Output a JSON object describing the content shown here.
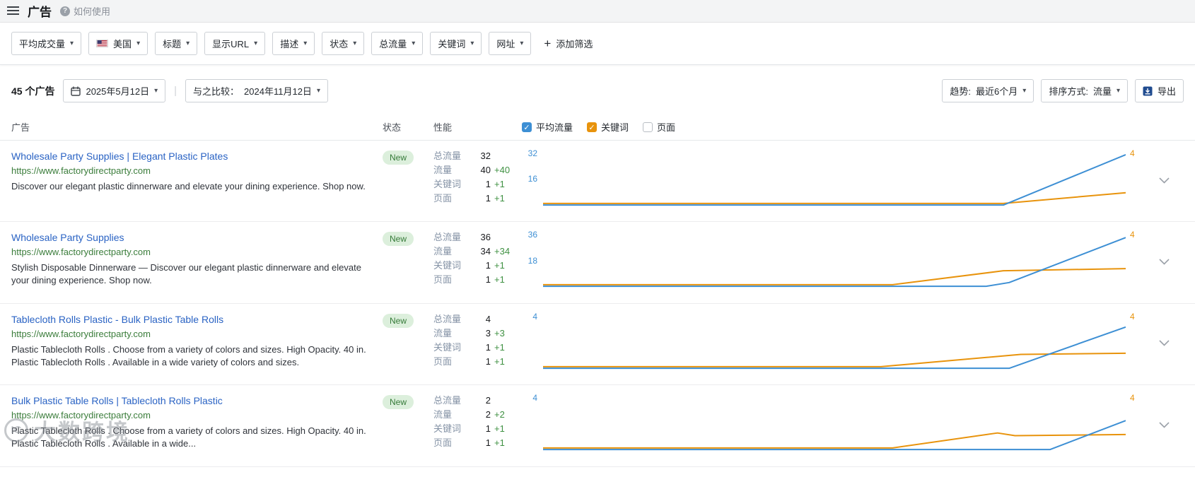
{
  "topbar": {
    "title": "广告",
    "help": "如何使用"
  },
  "filters": {
    "items": [
      {
        "label": "平均成交量",
        "flag": false
      },
      {
        "label": "美国",
        "flag": true
      },
      {
        "label": "标题",
        "flag": false
      },
      {
        "label": "显示URL",
        "flag": false
      },
      {
        "label": "描述",
        "flag": false
      },
      {
        "label": "状态",
        "flag": false
      },
      {
        "label": "总流量",
        "flag": false
      },
      {
        "label": "关键词",
        "flag": false
      },
      {
        "label": "网址",
        "flag": false
      }
    ],
    "add_label": "添加筛选"
  },
  "toolbar": {
    "count": "45 个广告",
    "date": "2025年5月12日",
    "compare_label": "与之比较：",
    "compare_value": "2024年11月12日",
    "trend_label": "趋势:",
    "trend_value": "最近6个月",
    "sort_label": "排序方式:",
    "sort_value": "流量",
    "export_label": "导出"
  },
  "table": {
    "columns": {
      "ad": "广告",
      "status": "状态",
      "performance": "性能"
    },
    "toggles": [
      {
        "label": "平均流量",
        "checked": true,
        "color": "#3d8fd4"
      },
      {
        "label": "关键词",
        "checked": true,
        "color": "#e8930c"
      },
      {
        "label": "页面",
        "checked": false,
        "color": ""
      }
    ]
  },
  "colors": {
    "series_blue": "#3d8fd4",
    "series_orange": "#e8930c"
  },
  "rows": [
    {
      "title": "Wholesale Party Supplies | Elegant Plastic Plates",
      "url": "https://www.factorydirectparty.com",
      "description": "Discover our elegant plastic dinnerware and elevate your dining experience. Shop now.",
      "status": "New",
      "metrics": [
        {
          "label": "总流量",
          "value": "32",
          "delta": ""
        },
        {
          "label": "流量",
          "value": "40",
          "delta": "+40"
        },
        {
          "label": "关键词",
          "value": "1",
          "delta": "+1"
        },
        {
          "label": "页面",
          "value": "1",
          "delta": "+1"
        }
      ],
      "chart": {
        "left_labels": [
          {
            "text": "32",
            "pos": 0
          },
          {
            "text": "16",
            "pos": 0.44
          }
        ],
        "right_labels": [
          {
            "text": "4",
            "pos": 0
          }
        ],
        "series": [
          {
            "color": "orange",
            "points": [
              [
                0,
                0.04
              ],
              [
                0.79,
                0.04
              ],
              [
                1,
                0.24
              ]
            ]
          },
          {
            "color": "blue",
            "points": [
              [
                0,
                0.01
              ],
              [
                0.79,
                0.01
              ],
              [
                1,
                0.95
              ]
            ]
          }
        ]
      }
    },
    {
      "title": "Wholesale Party Supplies",
      "url": "https://www.factorydirectparty.com",
      "description": "Stylish Disposable Dinnerware — Discover our elegant plastic dinnerware and elevate your dining experience. Shop now.",
      "status": "New",
      "metrics": [
        {
          "label": "总流量",
          "value": "36",
          "delta": ""
        },
        {
          "label": "流量",
          "value": "34",
          "delta": "+34"
        },
        {
          "label": "关键词",
          "value": "1",
          "delta": "+1"
        },
        {
          "label": "页面",
          "value": "1",
          "delta": "+1"
        }
      ],
      "chart": {
        "left_labels": [
          {
            "text": "36",
            "pos": 0
          },
          {
            "text": "18",
            "pos": 0.44
          }
        ],
        "right_labels": [
          {
            "text": "4",
            "pos": 0
          }
        ],
        "series": [
          {
            "color": "orange",
            "points": [
              [
                0,
                0.04
              ],
              [
                0.6,
                0.04
              ],
              [
                0.79,
                0.3
              ],
              [
                1,
                0.34
              ]
            ]
          },
          {
            "color": "blue",
            "points": [
              [
                0,
                0.01
              ],
              [
                0.76,
                0.01
              ],
              [
                0.8,
                0.08
              ],
              [
                1,
                0.92
              ]
            ]
          }
        ]
      }
    },
    {
      "title": "Tablecloth Rolls Plastic - Bulk Plastic Table Rolls",
      "url": "https://www.factorydirectparty.com",
      "description": "Plastic Tablecloth Rolls . Choose from a variety of colors and sizes. High Opacity. 40 in. Plastic Tablecloth Rolls . Available in a wide variety of colors and sizes.",
      "status": "New",
      "metrics": [
        {
          "label": "总流量",
          "value": "4",
          "delta": ""
        },
        {
          "label": "流量",
          "value": "3",
          "delta": "+3"
        },
        {
          "label": "关键词",
          "value": "1",
          "delta": "+1"
        },
        {
          "label": "页面",
          "value": "1",
          "delta": "+1"
        }
      ],
      "chart": {
        "left_labels": [
          {
            "text": "4",
            "pos": 0
          }
        ],
        "right_labels": [
          {
            "text": "4",
            "pos": 0
          }
        ],
        "series": [
          {
            "color": "orange",
            "points": [
              [
                0,
                0.04
              ],
              [
                0.58,
                0.04
              ],
              [
                0.82,
                0.27
              ],
              [
                1,
                0.29
              ]
            ]
          },
          {
            "color": "blue",
            "points": [
              [
                0,
                0.01
              ],
              [
                0.8,
                0.01
              ],
              [
                1,
                0.78
              ]
            ]
          }
        ]
      }
    },
    {
      "title": "Bulk Plastic Table Rolls | Tablecloth Rolls Plastic",
      "url": "https://www.factorydirectparty.com",
      "description": "Plastic Tablecloth Rolls . Choose from a variety of colors and sizes. High Opacity. 40 in. Plastic Tablecloth Rolls . Available in a wide...",
      "status": "New",
      "metrics": [
        {
          "label": "总流量",
          "value": "2",
          "delta": ""
        },
        {
          "label": "流量",
          "value": "2",
          "delta": "+2"
        },
        {
          "label": "关键词",
          "value": "1",
          "delta": "+1"
        },
        {
          "label": "页面",
          "value": "1",
          "delta": "+1"
        }
      ],
      "chart": {
        "left_labels": [
          {
            "text": "4",
            "pos": 0
          }
        ],
        "right_labels": [
          {
            "text": "4",
            "pos": 0
          }
        ],
        "series": [
          {
            "color": "orange",
            "points": [
              [
                0,
                0.04
              ],
              [
                0.6,
                0.04
              ],
              [
                0.78,
                0.32
              ],
              [
                0.81,
                0.27
              ],
              [
                1,
                0.29
              ]
            ]
          },
          {
            "color": "blue",
            "points": [
              [
                0,
                0.01
              ],
              [
                0.87,
                0.01
              ],
              [
                1,
                0.55
              ]
            ]
          }
        ]
      }
    }
  ],
  "watermark": {
    "logo": "IC",
    "text": "大数跨境"
  }
}
